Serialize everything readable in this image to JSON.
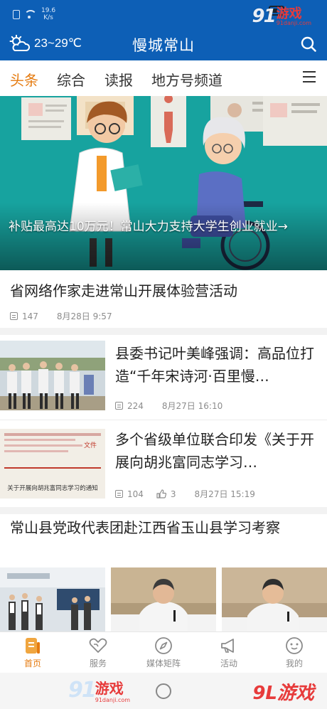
{
  "status_bar": {
    "speed_value": "19.6",
    "speed_unit": "K/s"
  },
  "watermark": {
    "top_number": "91",
    "top_text": "游戏",
    "top_sub": "91danji.com",
    "bottom_left_number": "91",
    "bottom_left_text": "游戏",
    "bottom_left_sub": "91danji.com",
    "bottom_right_text": "9L游戏"
  },
  "header": {
    "weather_icon": "partly-cloudy-icon",
    "temperature": "23~29℃",
    "title": "慢城常山",
    "search_icon": "search-icon"
  },
  "tabs": [
    {
      "label": "头条",
      "active": true
    },
    {
      "label": "综合",
      "active": false
    },
    {
      "label": "读报",
      "active": false
    },
    {
      "label": "地方号频道",
      "active": false
    }
  ],
  "hero": {
    "caption": "补贴最高达10万元！常山大力支持大学生创业就业→"
  },
  "news": [
    {
      "title": "省网络作家走进常山开展体验营活动",
      "comments": "147",
      "date": "8月28日 9:57"
    },
    {
      "title": "县委书记叶美峰强调：高品位打造“千年宋诗河·百里慢…",
      "comments": "224",
      "date": "8月27日 16:10"
    },
    {
      "title": "多个省级单位联合印发《关于开展向胡兆富同志学习…",
      "comments": "104",
      "likes": "3",
      "date": "8月27日 15:19",
      "thumb_doc_title": "关于开展向胡兆富同志学习的通知",
      "thumb_doc_stamp": "文件"
    },
    {
      "title": "常山县党政代表团赴江西省玉山县学习考察"
    }
  ],
  "bottom_nav": [
    {
      "label": "首页",
      "icon": "home-doc-icon",
      "active": true
    },
    {
      "label": "服务",
      "icon": "heart-service-icon",
      "active": false
    },
    {
      "label": "媒体矩阵",
      "icon": "compass-icon",
      "active": false
    },
    {
      "label": "活动",
      "icon": "megaphone-icon",
      "active": false
    },
    {
      "label": "我的",
      "icon": "smiley-profile-icon",
      "active": false
    }
  ],
  "colors": {
    "header_blue": "#0d5fb6",
    "accent_orange": "#e57b10",
    "meta_gray": "#8c8c8c",
    "watermark_red": "#e73b3b"
  }
}
